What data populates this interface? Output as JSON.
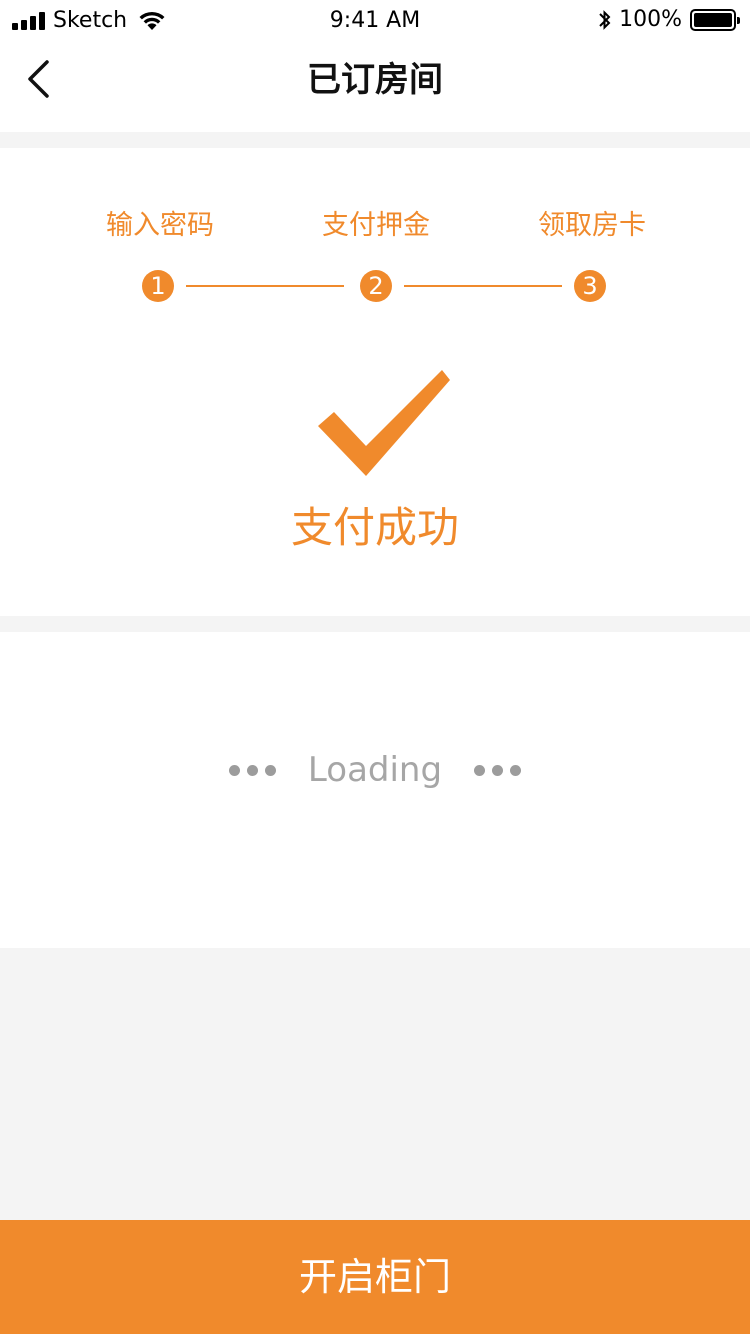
{
  "status_bar": {
    "carrier": "Sketch",
    "time": "9:41 AM",
    "battery": "100%"
  },
  "nav": {
    "title": "已订房间",
    "back_icon": "chevron-left-icon"
  },
  "steps": [
    {
      "label": "输入密码",
      "number": "1"
    },
    {
      "label": "支付押金",
      "number": "2"
    },
    {
      "label": "领取房卡",
      "number": "3"
    }
  ],
  "result": {
    "icon": "checkmark-icon",
    "text": "支付成功"
  },
  "loading": {
    "text": "Loading"
  },
  "action": {
    "label": "开启柜门"
  },
  "colors": {
    "accent": "#f08a2c",
    "background": "#f4f4f4",
    "loading_gray": "#a6a6a6"
  }
}
